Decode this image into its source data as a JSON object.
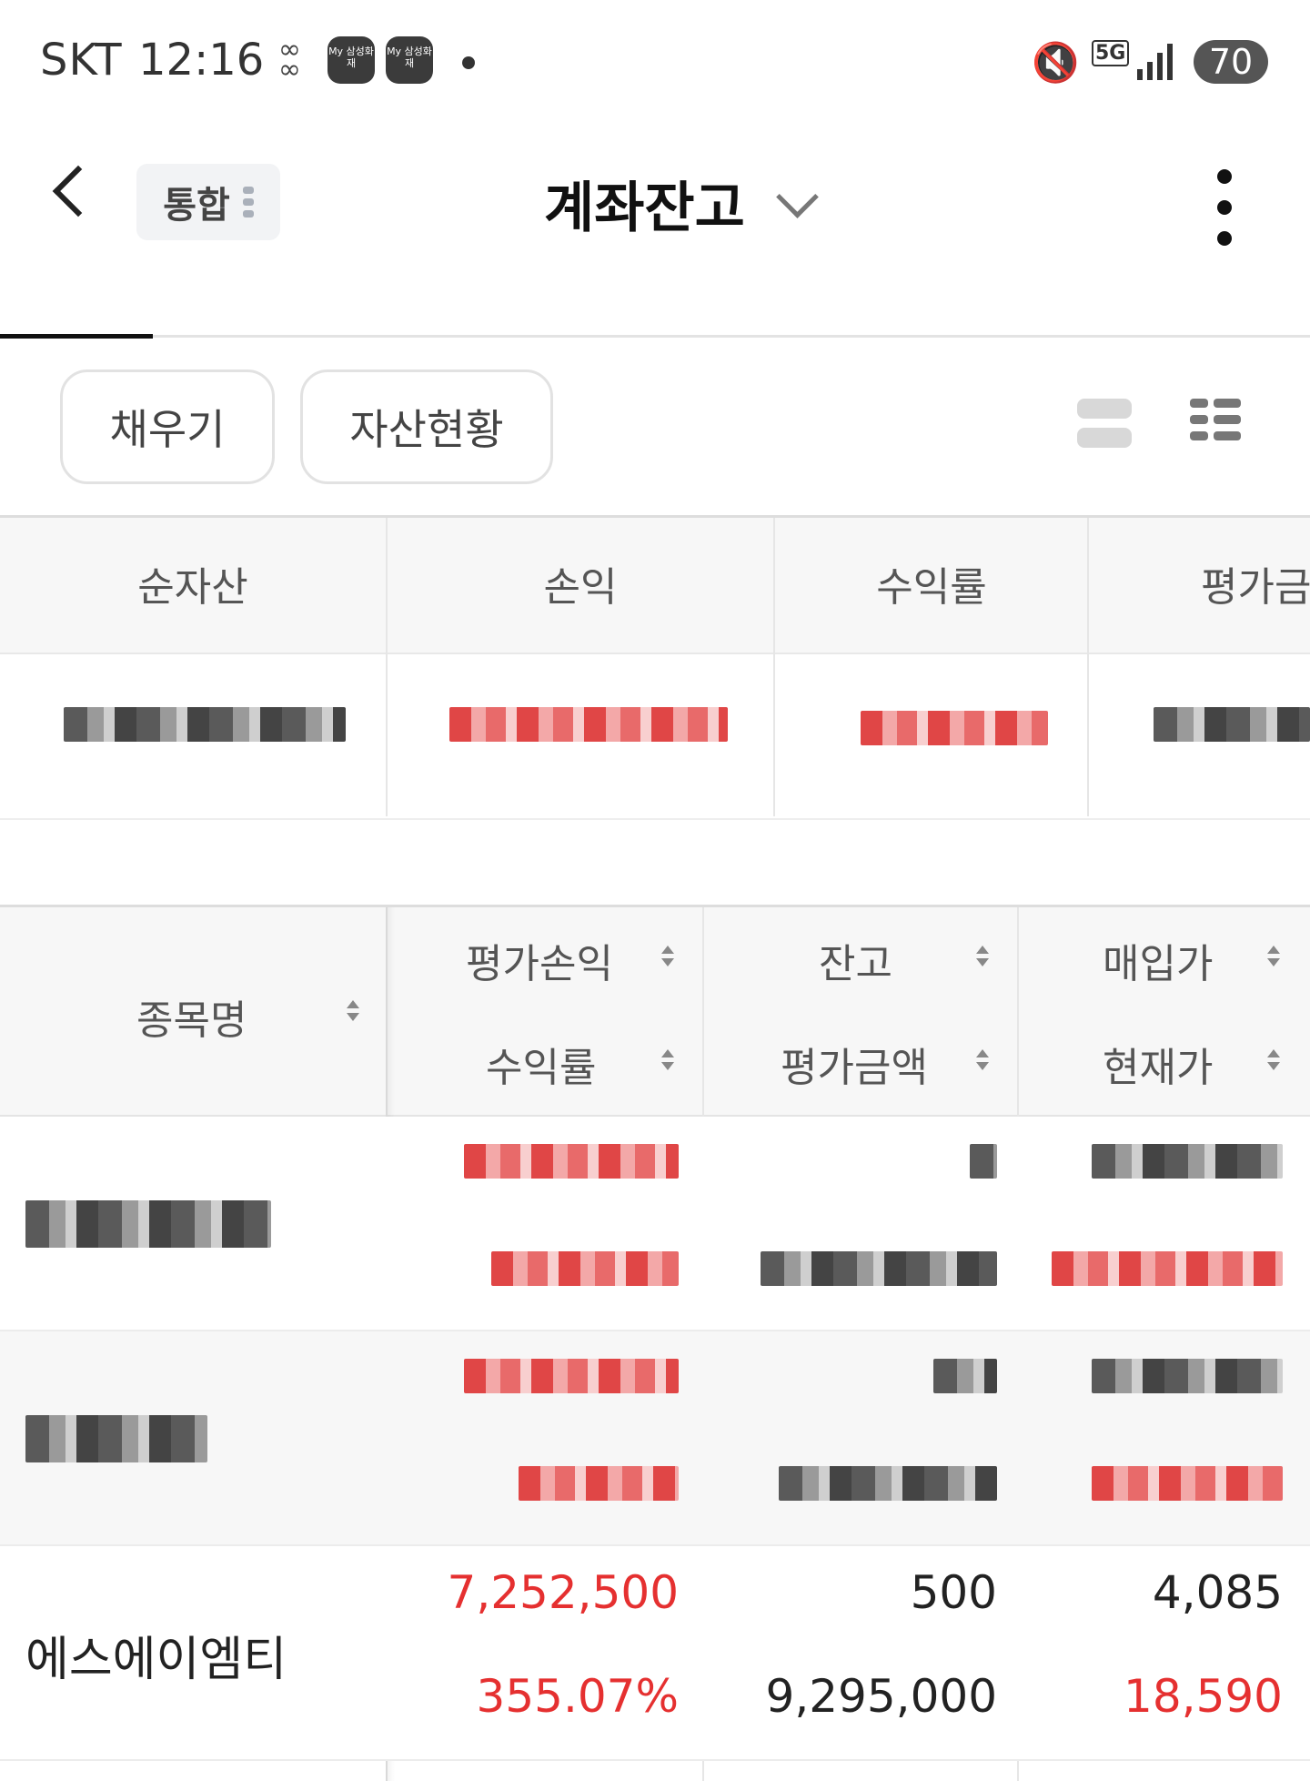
{
  "status_bar": {
    "carrier": "SKT",
    "time": "12:16",
    "app_icon_1": "My 삼성화재",
    "app_icon_2": "My 삼성화재",
    "network": "5G",
    "battery": "70"
  },
  "header": {
    "chip_label": "통합",
    "title": "계좌잔고",
    "icons": [
      "back-icon",
      "chevron-down-icon",
      "more-vertical-icon"
    ]
  },
  "actions": {
    "fill_button": "채우기",
    "assets_button": "자산현황",
    "view_icons": [
      "list-view-icon",
      "grid-view-icon"
    ]
  },
  "summary": {
    "headers": [
      "순자산",
      "손익",
      "수익률",
      "평가금"
    ]
  },
  "holdings": {
    "headers": {
      "name": "종목명",
      "pnl": "평가손익",
      "rate": "수익률",
      "qty": "잔고",
      "eval": "평가금액",
      "buy": "매입가",
      "current": "현재가"
    },
    "rows": [
      {
        "name": "",
        "pnl": "",
        "rate": "",
        "qty": "",
        "eval": "",
        "buy": "",
        "current": ""
      },
      {
        "name": "",
        "pnl": "",
        "rate": "",
        "qty": "",
        "eval": "",
        "buy": "",
        "current": ""
      },
      {
        "name": "에스에이엠티",
        "pnl": "7,252,500",
        "rate": "355.07%",
        "qty": "500",
        "eval": "9,295,000",
        "buy": "4,085",
        "current": "18,590"
      }
    ]
  },
  "colors": {
    "gain": "#e53030",
    "accent_line": "#111111"
  }
}
